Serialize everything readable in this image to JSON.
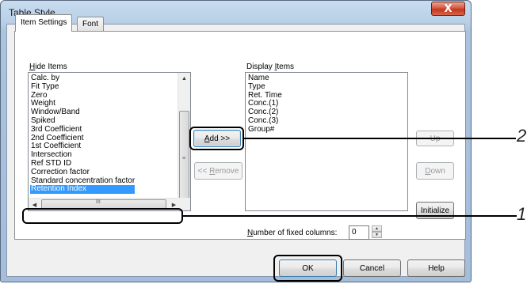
{
  "window": {
    "title": "Table Style",
    "close_glyph": "X"
  },
  "tabs": [
    {
      "label": "Item Settings",
      "active": true
    },
    {
      "label": "Font",
      "active": false
    }
  ],
  "hide_items": {
    "label_accel": "H",
    "label_rest": "ide Items",
    "items": [
      "Calc. by",
      "Fit Type",
      "Zero",
      "Weight",
      "Window/Band",
      "Spiked",
      "3rd Coefficient",
      "2nd Coefficient",
      "1st Coefficient",
      "Intersection",
      "Ref STD ID",
      "Correction factor",
      "Standard concentration factor",
      "Retention Index"
    ],
    "selected": "Retention Index",
    "hscroll_thumb_glyph": "III"
  },
  "display_items": {
    "label_pre": "Display ",
    "label_accel": "I",
    "label_rest": "tems",
    "items": [
      "Name",
      "Type",
      "Ret. Time",
      "Conc.(1)",
      "Conc.(2)",
      "Conc.(3)",
      "Group#"
    ]
  },
  "buttons": {
    "add_accel": "A",
    "add_rest": "dd >>",
    "remove_pre": "<< ",
    "remove_accel": "R",
    "remove_rest": "emove",
    "up": "Up",
    "down_accel": "D",
    "down_rest": "own",
    "initialize": "Initialize",
    "ok": "OK",
    "cancel": "Cancel",
    "help": "Help"
  },
  "fixed_columns": {
    "label_accel": "N",
    "label_rest": "umber of fixed columns:",
    "value": "0"
  },
  "callouts": {
    "one": "1",
    "two": "2"
  }
}
